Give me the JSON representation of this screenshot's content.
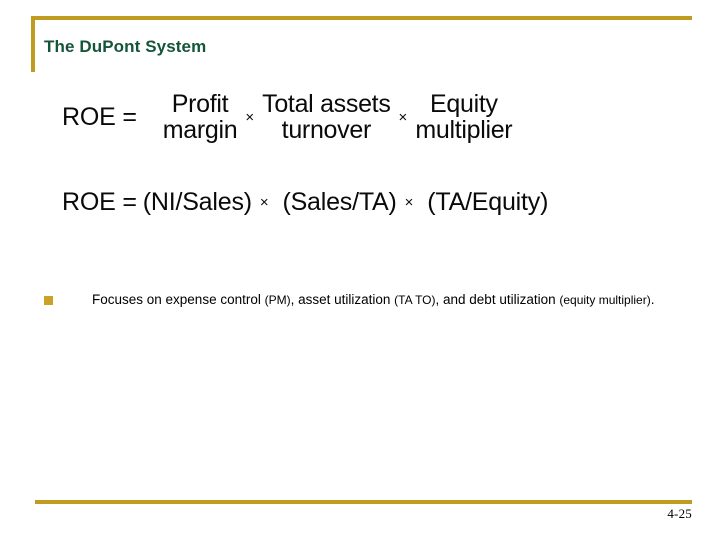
{
  "slide": {
    "title": "The DuPont System",
    "page_number": "4-25",
    "accent_color": "#bf9c20",
    "title_color": "#14553a",
    "bullet_color": "#c9a227",
    "background_color": "#ffffff"
  },
  "equation_line1": {
    "lhs": "ROE =",
    "terms": [
      {
        "numerator": "Profit",
        "denominator": "margin"
      },
      {
        "numerator": "Total assets",
        "denominator": "turnover"
      },
      {
        "numerator": "Equity",
        "denominator": "multiplier"
      }
    ],
    "operator": "×"
  },
  "equation_line2": {
    "lhs": "ROE =",
    "terms": [
      "(NI/Sales)",
      "(Sales/TA)",
      "(TA/Equity)"
    ],
    "operator": "×"
  },
  "bullets": [
    {
      "marker": "square-bullet",
      "part1": "Focuses on expense control ",
      "part2": "(PM)",
      "part3": ", asset utilization ",
      "part4": "(TA TO)",
      "part5": ", and debt utilization ",
      "part6": "(equity multiplier)",
      "part7": "."
    }
  ]
}
